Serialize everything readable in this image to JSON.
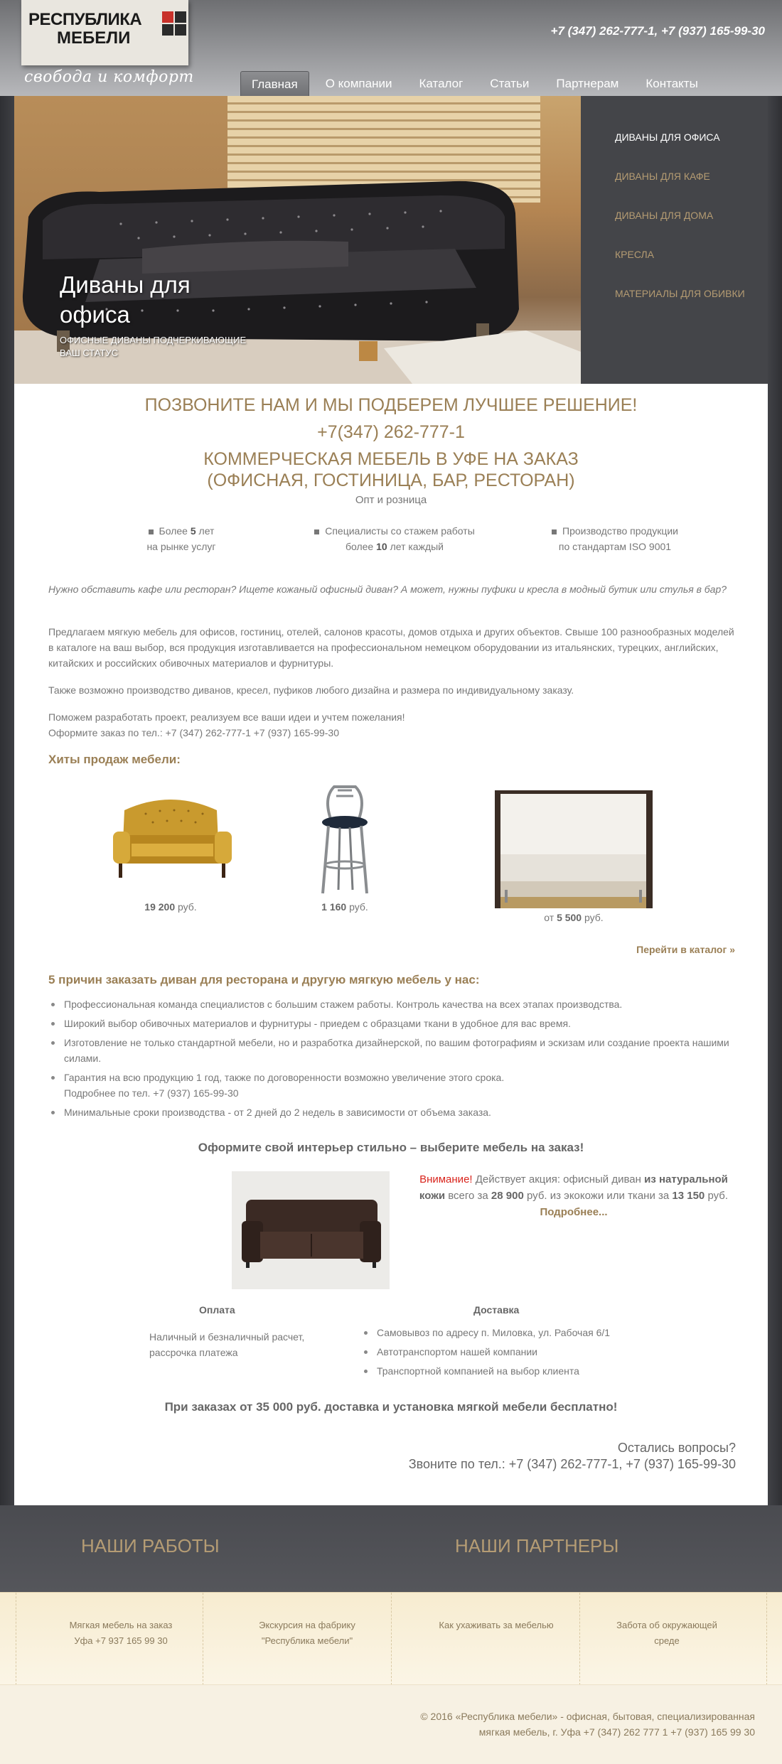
{
  "header": {
    "logo_line1": "РЕСПУБЛИКА",
    "logo_line2": "МЕБЕЛИ",
    "slogan": "свобода и комфорт",
    "phones": "+7 (347) 262-777-1, +7 (937) 165-99-30",
    "brand_colors": {
      "red": "#c8312a",
      "dark": "#2b2b2b",
      "gold": "#9a7f55"
    }
  },
  "nav": [
    "Главная",
    "О компании",
    "Каталог",
    "Статьи",
    "Партнерам",
    "Контакты"
  ],
  "hero": {
    "title": "Диваны для офиса",
    "subtitle": "Офисные диваны подчеркивающие ваш статус"
  },
  "sidemenu": [
    "ДИВАНЫ ДЛЯ ОФИСА",
    "ДИВАНЫ ДЛЯ КАФЕ",
    "ДИВАНЫ ДЛЯ ДОМА",
    "КРЕСЛА",
    "МАТЕРИАЛЫ ДЛЯ ОБИВКИ"
  ],
  "intro": {
    "call": "ПОЗВОНИТЕ НАМ И МЫ ПОДБЕРЕМ ЛУЧШЕЕ РЕШЕНИЕ!",
    "phone": "+7(347) 262-777-1",
    "h1_line1": "КОММЕРЧЕСКАЯ МЕБЕЛЬ В УФЕ НА ЗАКАЗ",
    "h1_line2": "(ОФИСНАЯ, ГОСТИНИЦА, БАР, РЕСТОРАН)",
    "sub": "Опт и розница"
  },
  "features": [
    {
      "pre": "Более ",
      "num": "5",
      "post": " лет",
      "line2": "на рынке услуг"
    },
    {
      "pre": "Специалисты со стажем работы",
      "line2_pre": "более ",
      "num": "10",
      "line2_post": " лет каждый"
    },
    {
      "pre": "Производство продукции",
      "line2": "по стандартам ISO 9001"
    }
  ],
  "paragraphs": {
    "italic": "Нужно обставить кафе или ресторан? Ищете кожаный офисный диван? А может, нужны пуфики и кресла в модный бутик или стулья в бар?",
    "p1": "Предлагаем мягкую мебель для офисов, гостиниц, отелей, салонов красоты, домов отдыха и других объектов. Свыше 100 разнообразных моделей в каталоге на ваш выбор, вся продукция изготавливается на профессиональном немецком оборудовании из итальянских, турецких, английских, китайских и российских обивочных материалов и фурнитуры.",
    "p2": "Также возможно производство диванов, кресел, пуфиков любого дизайна и размера по индивидуальному заказу.",
    "p3a": "Поможем разработать проект, реализуем все ваши идеи и учтем пожелания!",
    "p3b": "Оформите заказ по тел.: +7 (347) 262-777-1   +7 (937) 165-99-30"
  },
  "hits": {
    "title": "Хиты продаж мебели:",
    "items": [
      {
        "price": "19 200",
        "unit": " руб."
      },
      {
        "price": "1 160",
        "unit": " руб."
      },
      {
        "pre": "от ",
        "price": "5 500",
        "unit": " руб."
      }
    ],
    "catalog_link": "Перейти в каталог »"
  },
  "reasons": {
    "title": "5 причин заказать диван для ресторана и другую мягкую мебель у нас:",
    "items": [
      "Профессиональная команда специалистов с большим стажем работы. Контроль качества на всех этапах производства.",
      "Широкий выбор обивочных материалов и фурнитуры - приедем с образцами ткани в удобное для вас время.",
      "Изготовление не только стандартной мебели, но и разработка дизайнерской, по вашим фотографиям и эскизам или создание проекта нашими силами.",
      "Гарантия на всю продукцию 1 год, также по договоренности возможно увеличение этого срока.\nПодробнее по тел. +7 (937) 165-99-30",
      "Минимальные сроки производства - от 2 дней до 2 недель в зависимости от объема заказа."
    ]
  },
  "promo": {
    "heading": "Оформите свой интерьер стильно – выберите мебель на заказ!",
    "attention": "Внимание!",
    "t1": " Действует акция: офисный диван ",
    "b1": "из натуральной кожи",
    "t2": " всего за ",
    "b2": "28 900",
    "t3": " руб. из экокожи или ткани за ",
    "b3": "13 150",
    "t4": " руб. ",
    "more": "Подробнее..."
  },
  "payment": {
    "title": "Оплата",
    "text1": "Наличный и безналичный расчет,",
    "text2": "рассрочка платежа"
  },
  "delivery": {
    "title": "Доставка",
    "items": [
      "Самовывоз по адресу п. Миловка, ул. Рабочая 6/1",
      "Автотранспортом нашей компании",
      "Транспортной компанией на выбор клиента"
    ]
  },
  "free_delivery": "При заказах от 35 000 руб. доставка и установка мягкой мебели бесплатно!",
  "questions": {
    "line1": "Остались вопросы?",
    "line2": "Звоните по тел.: +7 (347) 262-777-1, +7 (937) 165-99-30"
  },
  "bottom": {
    "works": "НАШИ РАБОТЫ",
    "partners": "НАШИ ПАРТНЕРЫ",
    "links": [
      {
        "l1": "Мягкая мебель на заказ",
        "l2": "Уфа +7 937 165 99 30"
      },
      {
        "l1": "Экскурсия на фабрику",
        "l2": "\"Республика мебели\""
      },
      {
        "l1": "Как ухаживать за мебелью",
        "l2": ""
      },
      {
        "l1": "Забота об окружающей",
        "l2": "среде"
      }
    ]
  },
  "footer": {
    "line1": "© 2016 «Республика мебели» - офисная, бытовая, специализированная",
    "line2": "мягкая мебель, г. Уфа +7 (347) 262 777 1   +7 (937) 165 99 30"
  }
}
